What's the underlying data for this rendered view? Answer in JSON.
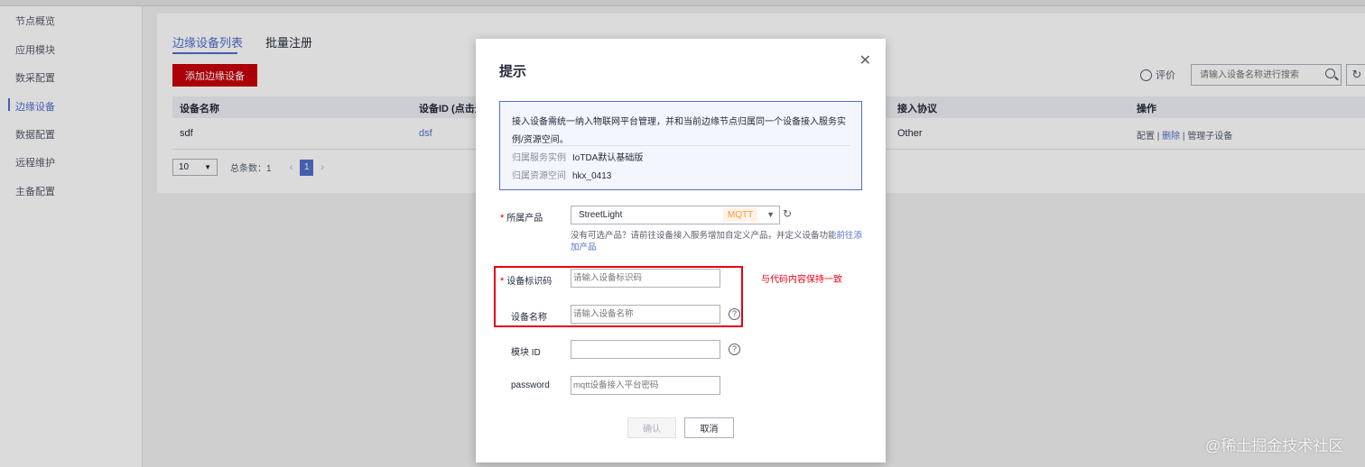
{
  "sidebar": {
    "items": [
      {
        "label": "节点概览"
      },
      {
        "label": "应用模块"
      },
      {
        "label": "数采配置"
      },
      {
        "label": "边缘设备"
      },
      {
        "label": "数据配置"
      },
      {
        "label": "远程维护"
      },
      {
        "label": "主备配置"
      }
    ],
    "active_index": 3
  },
  "tabs": [
    {
      "label": "边缘设备列表"
    },
    {
      "label": "批量注册"
    }
  ],
  "toolbar": {
    "add_label": "添加边缘设备",
    "rate_label": "评价",
    "rate_icon": "smile-icon",
    "search_placeholder": "请输入设备名称进行搜索",
    "refresh_icon": "refresh-icon"
  },
  "table": {
    "headers": [
      "设备名称",
      "设备ID (点击进",
      "接入协议",
      "操作"
    ],
    "rows": [
      {
        "name": "sdf",
        "id": "dsf",
        "protocol": "Other",
        "ops": [
          "配置",
          "删除",
          "管理子设备"
        ]
      }
    ]
  },
  "pagination": {
    "page_size": "10",
    "total": "总条数：1",
    "current_page": "1"
  },
  "dialog": {
    "title": "提示",
    "info_line1": "接入设备需统一纳入物联网平台管理，并和当前边缘节点归属同一个设备接入服务实",
    "info_line2": "例/资源空间。",
    "service_label": "归属服务实例",
    "service_value": "IoTDA默认基础版",
    "space_label": "归属资源空间",
    "space_value": "hkx_0413",
    "product_label": "所属产品",
    "product_value": "StreetLight",
    "product_tag": "MQTT",
    "hint_text": "没有可选产品？请前往设备接入服务增加自定义产品，并定义设备功能",
    "hint_link": "前往添加产品",
    "identifier_label": "设备标识码",
    "identifier_placeholder": "请输入设备标识码",
    "name_label": "设备名称",
    "name_placeholder": "请输入设备名称",
    "module_label": "模块 ID",
    "module_value": "",
    "password_label": "password",
    "password_placeholder": "mqtt设备接入平台密码",
    "ok_label": "确认",
    "cancel_label": "取消",
    "annotation": "与代码内容保持一致"
  },
  "watermark": "@稀土掘金技术社区",
  "colors": {
    "brand_red": "#c7000b",
    "link_blue": "#526ecc",
    "annotation_red": "#e60012",
    "tag_orange": "#fa9841"
  }
}
